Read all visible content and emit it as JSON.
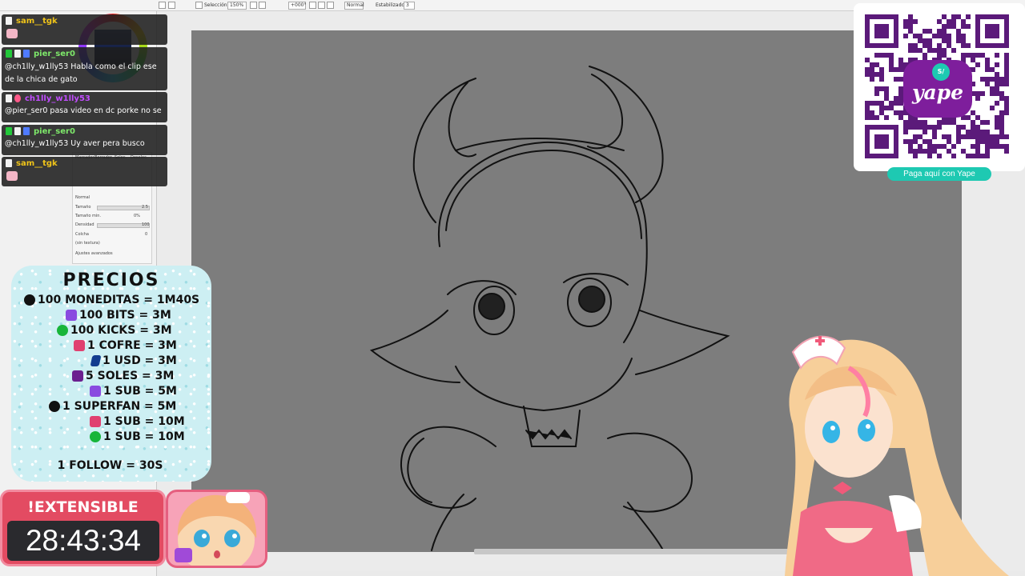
{
  "toolbar": {
    "selection_label": "Selección",
    "zoom_value": "150%",
    "rotation_value": "+000°",
    "blend_mode": "Normal",
    "stabilizer_label": "Estabilizador",
    "stabilizer_value": "3"
  },
  "tool_panel": {
    "tools": [
      "Marcador",
      "Borrador",
      "Selec.",
      "Deselec."
    ],
    "brush_mode": "Normal",
    "size_label": "Tamaño",
    "size_value": "2.5",
    "min_size_label": "Tamaño min.",
    "min_size_value": "0%",
    "density_label": "Densidad",
    "density_value": "100",
    "blur_label": "Colcha",
    "blur_value": "0",
    "texture_label": "(sin textura)",
    "advanced_label": "Ajustes avanzados"
  },
  "chat": [
    {
      "user": "sam__tgk",
      "user_color": "#f0c419",
      "message": ""
    },
    {
      "user": "pier_ser0",
      "user_color": "#7ee86a",
      "message": "@ch1lly_w1lly53 Habla como el clip ese de la chica de gato"
    },
    {
      "user": "ch1lly_w1lly53",
      "user_color": "#c24dff",
      "message": "@pier_ser0 pasa video en dc porke no se"
    },
    {
      "user": "pier_ser0",
      "user_color": "#7ee86a",
      "message": "@ch1lly_w1lly53 Uy aver pera busco"
    },
    {
      "user": "sam__tgk",
      "user_color": "#f0c419",
      "message": ""
    }
  ],
  "prices": {
    "title": "PRECIOS",
    "items": [
      {
        "icon": "tiktok-icon",
        "text": "100 MONEDITAS = 1M40S"
      },
      {
        "icon": "twitch-icon",
        "text": "100 BITS = 3M"
      },
      {
        "icon": "kick-icon",
        "text": "100 KICKS = 3M"
      },
      {
        "icon": "chest-icon",
        "text": "1 COFRE = 3M"
      },
      {
        "icon": "paypal-icon",
        "text": "1 USD = 3M"
      },
      {
        "icon": "yape-icon",
        "text": "5 SOLES = 3M"
      },
      {
        "icon": "twitch-icon",
        "text": "1 SUB = 5M"
      },
      {
        "icon": "tiktok-icon",
        "text": "1 SUPERFAN = 5M"
      },
      {
        "icon": "chest-icon",
        "text": "1 SUB = 10M"
      },
      {
        "icon": "kick-icon",
        "text": "1 SUB = 10M"
      }
    ],
    "follow": "1 FOLLOW = 30S"
  },
  "timer": {
    "label": "!EXTENSIBLE",
    "time": "28:43:34"
  },
  "yape": {
    "currency_badge": "S/",
    "logo_text": "yape",
    "button_label": "Paga aquí con Yape"
  },
  "colors": {
    "canvas": "#7d7d7d",
    "timer_red": "#e34b62",
    "prices_bg": "#cdeff3",
    "yape_purple": "#7e1e9c",
    "yape_teal": "#1ec9b2"
  }
}
